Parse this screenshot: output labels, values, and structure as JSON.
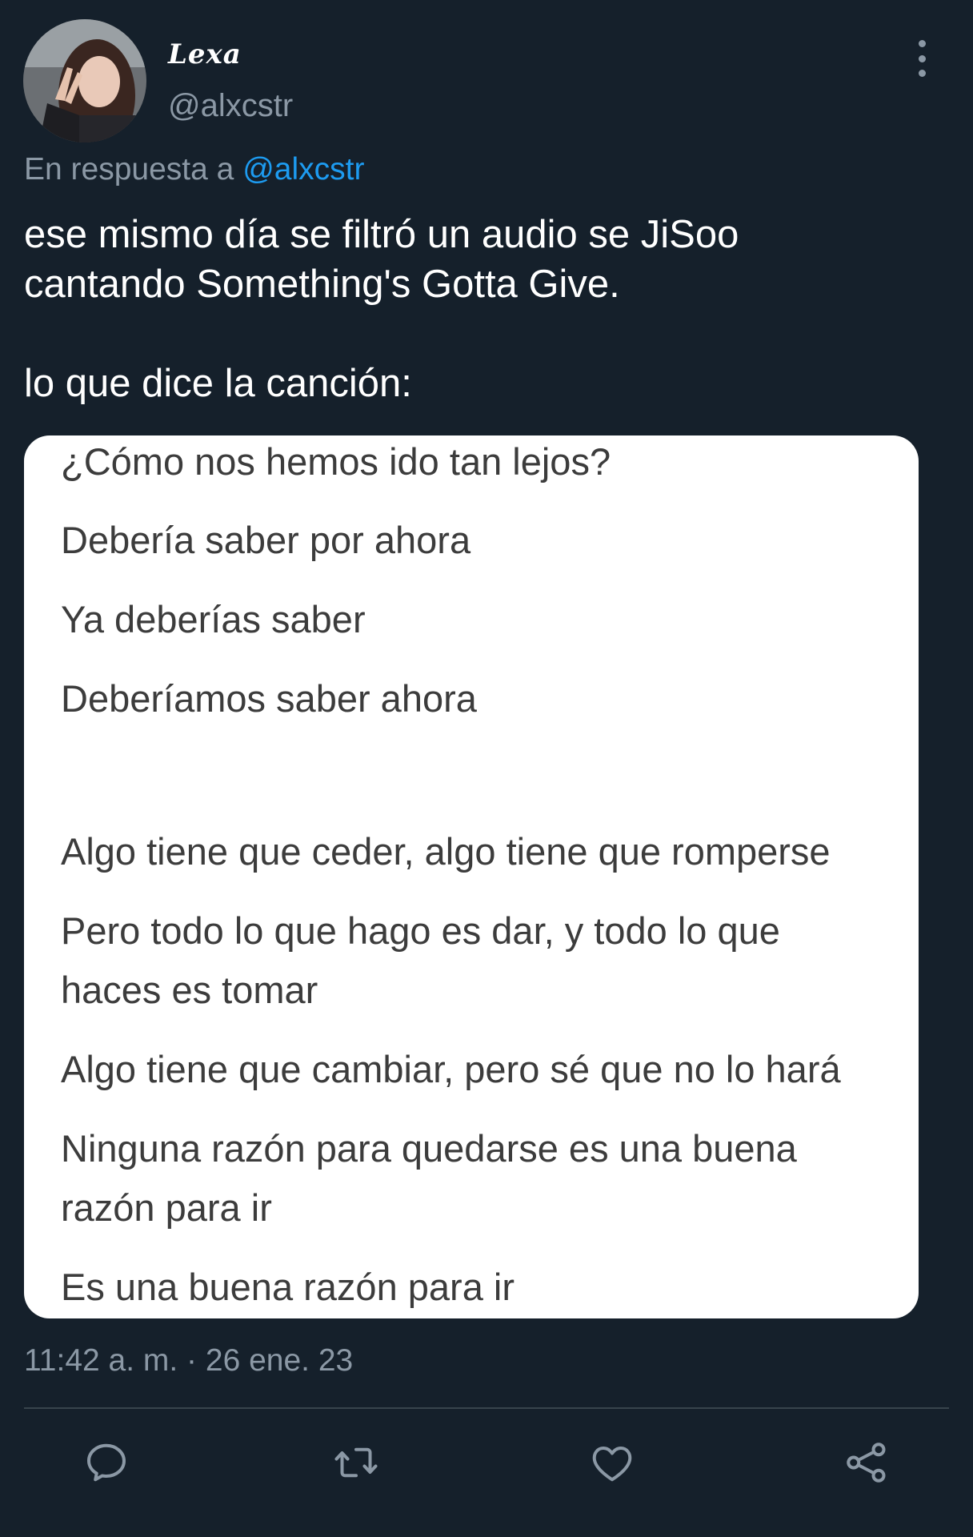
{
  "author": {
    "display_name": "Lexa",
    "handle": "@alxcstr",
    "avatar_icon": "profile-photo"
  },
  "reply": {
    "prefix": "En respuesta a",
    "mention": "@alxcstr"
  },
  "tweet": {
    "text_lines": [
      "ese mismo día se filtró un audio se JiSoo",
      "cantando Something's Gotta Give.",
      "lo que dice la canción:"
    ]
  },
  "media": {
    "background": "#ffffff",
    "lyrics": [
      "¿Cómo nos hemos ido tan lejos?",
      "Debería saber por ahora",
      "Ya deberías saber",
      "Deberíamos saber ahora",
      "Algo tiene que ceder, algo tiene que romperse",
      "Pero todo lo que hago es dar, y todo lo que",
      "haces es tomar",
      "Algo tiene que cambiar, pero sé que no lo hará",
      "Ninguna razón para quedarse es una buena",
      "razón para ir",
      "Es una buena razón para ir"
    ]
  },
  "timestamp": "11:42 a. m. · 26 ene. 23",
  "actions": {
    "icons": [
      "reply-icon",
      "retweet-icon",
      "like-icon",
      "share-icon"
    ],
    "icon_color": "#8b98a5"
  },
  "colors": {
    "background": "#15202b",
    "text": "#ffffff",
    "secondary": "#8b98a5",
    "accent": "#1d9bf0",
    "divider": "#38444d"
  }
}
